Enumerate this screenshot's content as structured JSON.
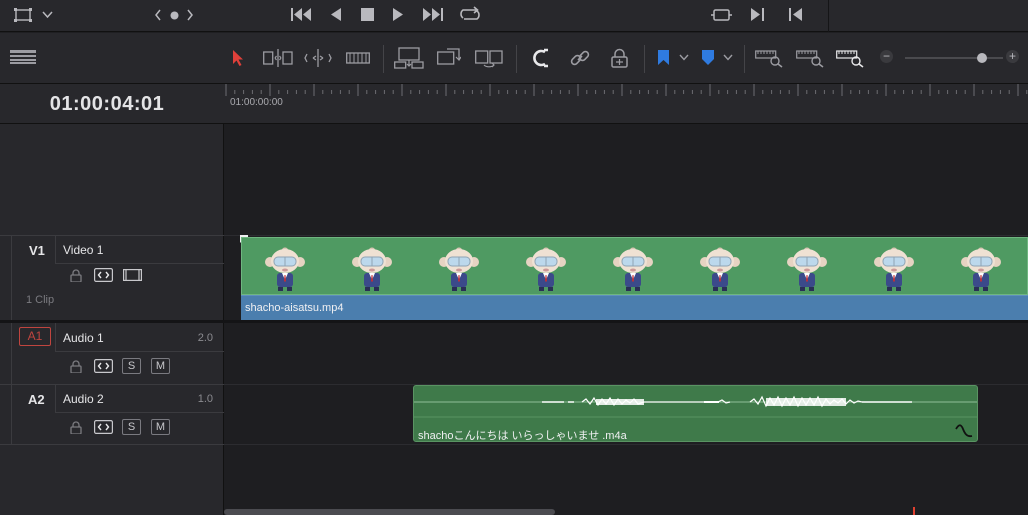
{
  "timeline": {
    "timecode": "01:00:04:01",
    "ruler_start": "01:00:00:00"
  },
  "toolbar": {
    "icons": [
      "layout-icon",
      "select-arrow-icon",
      "trim-icon",
      "dynamic-trim-icon",
      "blade-icon",
      "insert-icon",
      "overwrite-icon",
      "replace-icon",
      "snap-icon",
      "link-icon",
      "lock-icon",
      "flag-icon",
      "marker-icon",
      "zoom-full-icon",
      "zoom-detail-icon",
      "zoom-custom-icon"
    ],
    "zoom_minus": "−",
    "zoom_plus": "+",
    "zoom_level": 0.79,
    "accent": "#e0403a",
    "flag_color": "#2f7be0"
  },
  "tracks": {
    "v1": {
      "id": "V1",
      "name": "Video 1",
      "clip_count": "1 Clip"
    },
    "a1": {
      "id": "A1",
      "name": "Audio 1",
      "channels": "2.0"
    },
    "a2": {
      "id": "A2",
      "name": "Audio 2",
      "channels": "1.0"
    },
    "solo_label": "S",
    "mute_label": "M"
  },
  "clips": {
    "video": {
      "name": "shacho-aisatsu.mp4",
      "color": "#4f9a62",
      "strip_color": "#4b7eae"
    },
    "audio": {
      "name": "shachoこんにちは いらっしゃいませ .m4a",
      "color": "#3f7a4a"
    }
  }
}
